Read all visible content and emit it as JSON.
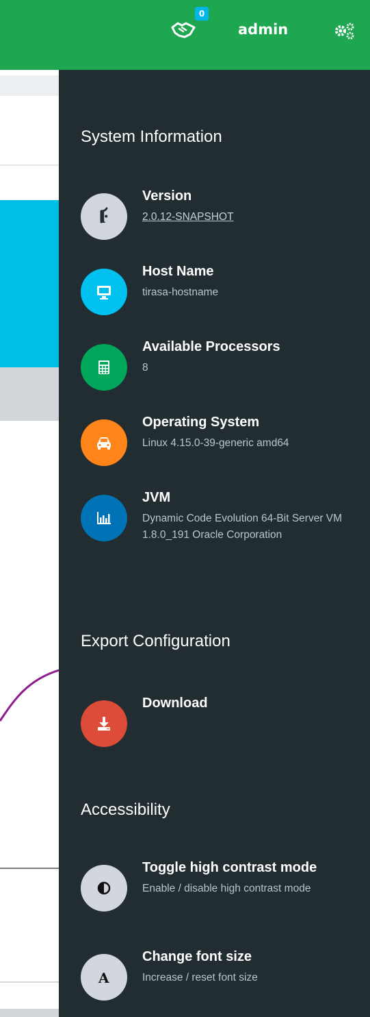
{
  "header": {
    "tasks_count": "0",
    "user": "admin"
  },
  "sidebar": {
    "system_info_heading": "System Information",
    "export_heading": "Export Configuration",
    "accessibility_heading": "Accessibility",
    "version": {
      "label": "Version",
      "value": "2.0.12-SNAPSHOT",
      "icon": "code-fork-icon",
      "color": "#d2d6de"
    },
    "hostname": {
      "label": "Host Name",
      "value": "tirasa-hostname",
      "icon": "desktop-icon",
      "color": "#00c0ef"
    },
    "processors": {
      "label": "Available Processors",
      "value": "8",
      "icon": "calculator-icon",
      "color": "#00a65a"
    },
    "os": {
      "label": "Operating System",
      "value": "Linux 4.15.0-39-generic amd64",
      "icon": "car-icon",
      "color": "#ff851b"
    },
    "jvm": {
      "label": "JVM",
      "value": "Dynamic Code Evolution 64-Bit Server VM 1.8.0_191 Oracle Corporation",
      "icon": "bar-chart-icon",
      "color": "#0073b7"
    },
    "download": {
      "label": "Download",
      "icon": "download-icon",
      "color": "#dd4b39"
    },
    "contrast": {
      "label": "Toggle high contrast mode",
      "value": "Enable / disable high contrast mode",
      "icon": "adjust-icon",
      "color": "#d2d6de"
    },
    "fontsize": {
      "label": "Change font size",
      "value": "Increase / reset font size",
      "icon": "font-icon",
      "color": "#d2d6de"
    }
  },
  "colors": {
    "topbar": "#1fa651",
    "sidebar_bg": "#222d32"
  }
}
